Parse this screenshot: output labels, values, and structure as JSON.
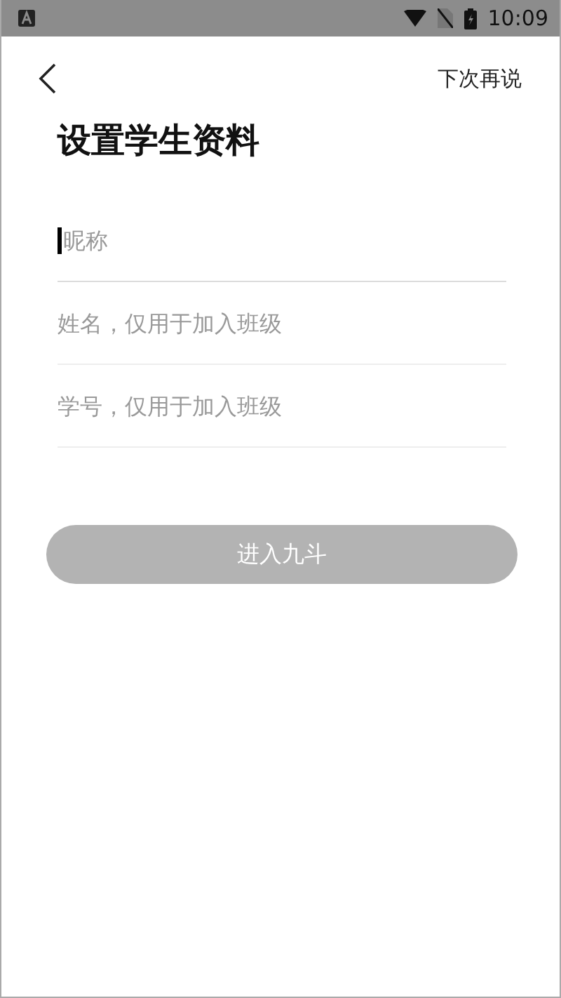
{
  "status_bar": {
    "time": "10:09"
  },
  "header": {
    "skip": "下次再说"
  },
  "title": "设置学生资料",
  "fields": [
    {
      "placeholder": "昵称",
      "focused": true
    },
    {
      "placeholder": "姓名，仅用于加入班级",
      "focused": false
    },
    {
      "placeholder": "学号，仅用于加入班级",
      "focused": false
    }
  ],
  "submit": {
    "label": "进入九斗",
    "disabled": true
  }
}
